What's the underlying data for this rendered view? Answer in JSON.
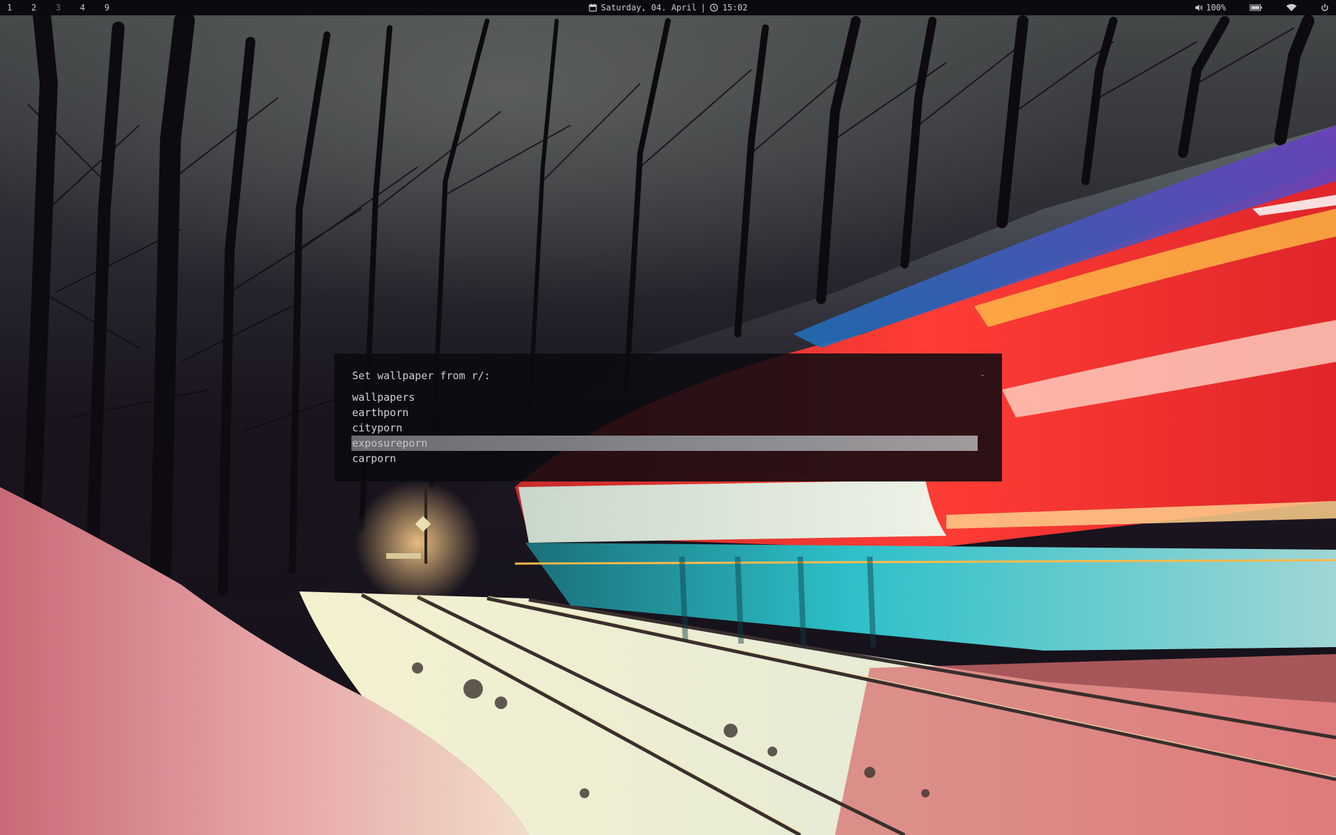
{
  "topbar": {
    "workspaces": [
      "1",
      "2",
      "3",
      "4",
      "9"
    ],
    "active_workspace": "3",
    "date": "Saturday, 04. April",
    "separator": "|",
    "time": "15:02",
    "volume": "100%",
    "icons": {
      "calendar": "calendar-icon",
      "clock": "clock-icon",
      "volume": "volume-icon",
      "battery": "battery-icon",
      "wifi": "wifi-icon",
      "power": "power-icon"
    }
  },
  "menu": {
    "prompt": "Set wallpaper from r/:",
    "input_value": "",
    "case_indicator": "-",
    "entries": [
      "wallpapers",
      "earthporn",
      "cityporn",
      "exposureporn",
      "carporn"
    ],
    "selected_entry": "exposureporn"
  },
  "colors": {
    "bar_background": "#0b0a10",
    "bar_text": "#c9c9cf",
    "active_workspace": "#6f6f78",
    "menu_background": "#0c0b10",
    "selection": "#8a8a90"
  }
}
